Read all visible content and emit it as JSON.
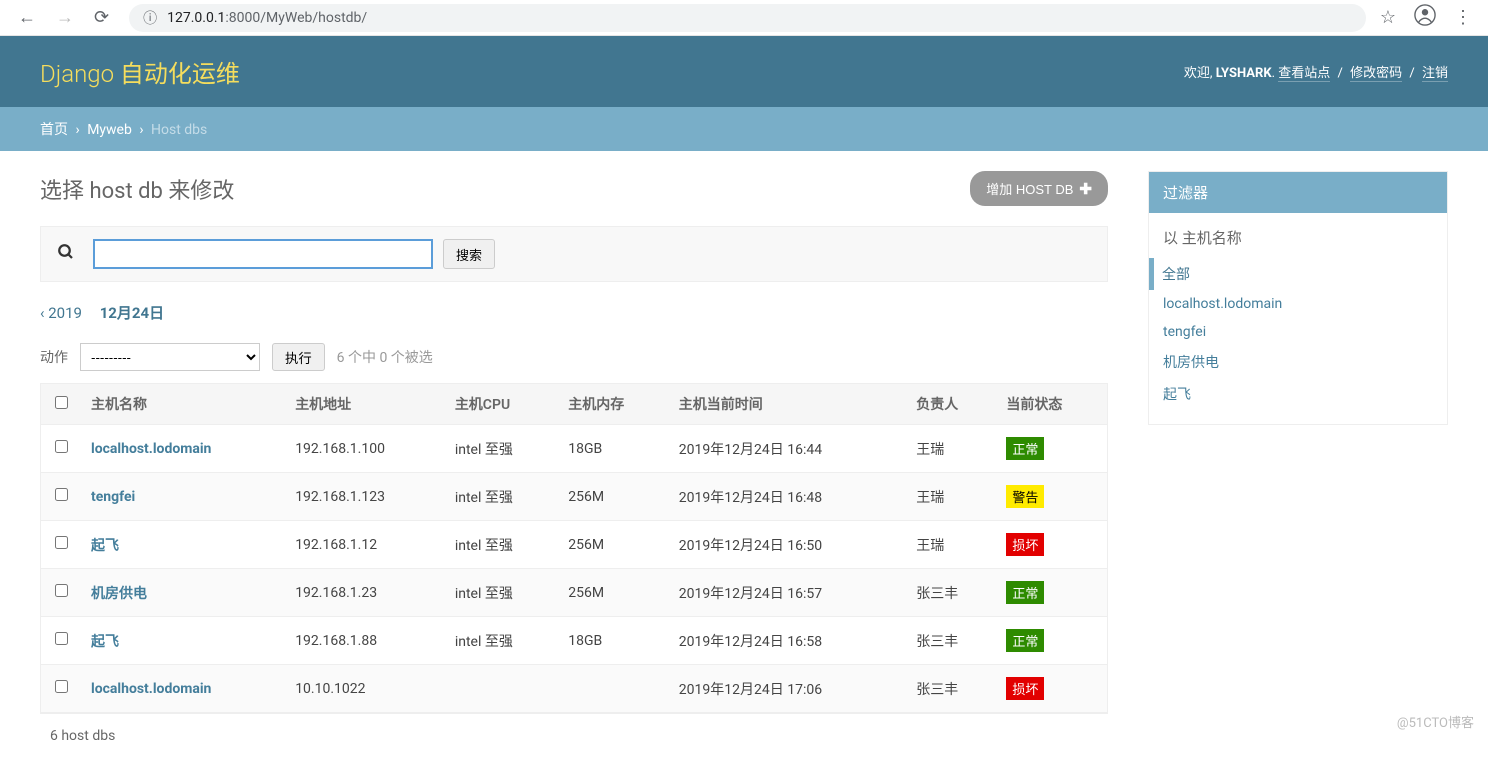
{
  "browser": {
    "url_host": "127.0.0.1",
    "url_port_path": ":8000/MyWeb/hostdb/"
  },
  "header": {
    "site_title": "Django 自动化运维",
    "welcome": "欢迎,",
    "username": "LYSHARK",
    "view_site": "查看站点",
    "change_password": "修改密码",
    "logout": "注销"
  },
  "breadcrumbs": {
    "home": "首页",
    "app": "Myweb",
    "model": "Host dbs"
  },
  "title": "选择 host db 来修改",
  "add_button": "增加 HOST DB",
  "search": {
    "button": "搜索",
    "placeholder": ""
  },
  "date_pager": {
    "prev": "‹ 2019",
    "current": "12月24日"
  },
  "actions": {
    "label": "动作",
    "placeholder": "---------",
    "go": "执行",
    "count": "6 个中 0 个被选"
  },
  "columns": {
    "name": "主机名称",
    "addr": "主机地址",
    "cpu": "主机CPU",
    "mem": "主机内存",
    "time": "主机当前时间",
    "owner": "负责人",
    "status": "当前状态"
  },
  "rows": [
    {
      "name": "localhost.lodomain",
      "addr": "192.168.1.100",
      "cpu": "intel 至强",
      "mem": "18GB",
      "time": "2019年12月24日 16:44",
      "owner": "王瑞",
      "status": "正常",
      "status_class": "status-normal"
    },
    {
      "name": "tengfei",
      "addr": "192.168.1.123",
      "cpu": "intel 至强",
      "mem": "256M",
      "time": "2019年12月24日 16:48",
      "owner": "王瑞",
      "status": "警告",
      "status_class": "status-warning"
    },
    {
      "name": "起飞",
      "addr": "192.168.1.12",
      "cpu": "intel 至强",
      "mem": "256M",
      "time": "2019年12月24日 16:50",
      "owner": "王瑞",
      "status": "损坏",
      "status_class": "status-broken"
    },
    {
      "name": "机房供电",
      "addr": "192.168.1.23",
      "cpu": "intel 至强",
      "mem": "256M",
      "time": "2019年12月24日 16:57",
      "owner": "张三丰",
      "status": "正常",
      "status_class": "status-normal"
    },
    {
      "name": "起飞",
      "addr": "192.168.1.88",
      "cpu": "intel 至强",
      "mem": "18GB",
      "time": "2019年12月24日 16:58",
      "owner": "张三丰",
      "status": "正常",
      "status_class": "status-normal"
    },
    {
      "name": "localhost.lodomain",
      "addr": "10.10.1022",
      "cpu": "",
      "mem": "",
      "time": "2019年12月24日 17:06",
      "owner": "张三丰",
      "status": "损坏",
      "status_class": "status-broken"
    }
  ],
  "result_count": "6 host dbs",
  "filter": {
    "title": "过滤器",
    "by_label": "以 主机名称",
    "items": [
      {
        "label": "全部",
        "active": true
      },
      {
        "label": "localhost.lodomain",
        "active": false
      },
      {
        "label": "tengfei",
        "active": false
      },
      {
        "label": "机房供电",
        "active": false
      },
      {
        "label": "起飞",
        "active": false
      }
    ]
  },
  "watermark": "@51CTO博客"
}
